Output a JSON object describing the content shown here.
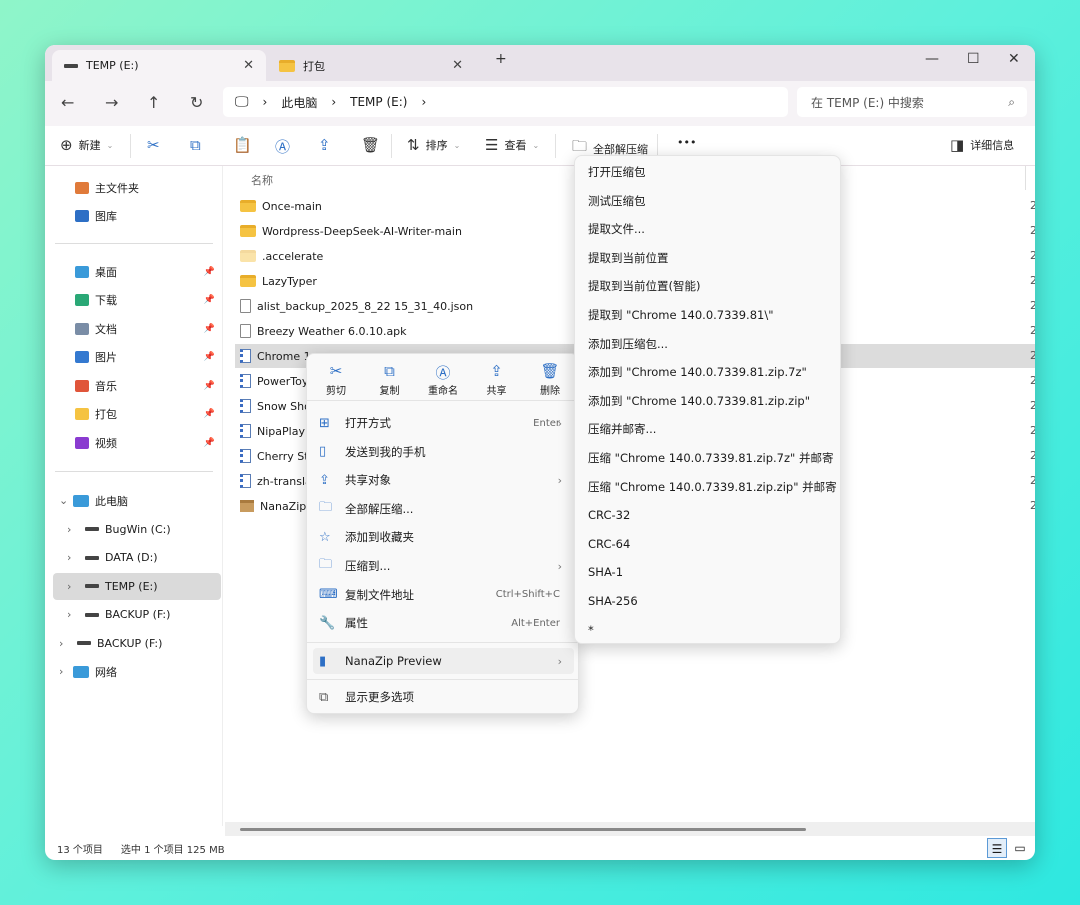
{
  "tabs": [
    {
      "label": "TEMP (E:)",
      "icon": "drive-icon"
    },
    {
      "label": "打包",
      "icon": "folder-icon"
    }
  ],
  "window": {
    "new_tab": "+",
    "minimize": "—",
    "maximize": "☐",
    "close": "✕"
  },
  "address": {
    "segments": [
      "此电脑",
      "TEMP (E:)"
    ],
    "search_placeholder": "在 TEMP (E:) 中搜索"
  },
  "toolbar": {
    "new": "新建",
    "sort": "排序",
    "view": "查看",
    "extract_all": "全部解压缩",
    "more": "•••",
    "details": "详细信息"
  },
  "sidebar": {
    "top": [
      {
        "label": "主文件夹",
        "color": "#e07a3a"
      },
      {
        "label": "图库",
        "color": "#2d6fc5"
      }
    ],
    "pinned": [
      {
        "label": "桌面",
        "color": "#3a9ad9"
      },
      {
        "label": "下载",
        "color": "#2aa876"
      },
      {
        "label": "文档",
        "color": "#7a8da6"
      },
      {
        "label": "图片",
        "color": "#3479d0"
      },
      {
        "label": "音乐",
        "color": "#e0553a"
      },
      {
        "label": "打包",
        "color": "#f5c342"
      },
      {
        "label": "视频",
        "color": "#8a3bd0"
      }
    ],
    "tree": [
      {
        "label": "此电脑",
        "level": 0,
        "chev": "⌄"
      },
      {
        "label": "BugWin (C:)",
        "level": 1,
        "chev": "›"
      },
      {
        "label": "DATA (D:)",
        "level": 1,
        "chev": "›"
      },
      {
        "label": "TEMP (E:)",
        "level": 1,
        "chev": "›",
        "selected": true
      },
      {
        "label": "BACKUP (F:)",
        "level": 1,
        "chev": "›"
      },
      {
        "label": "BACKUP (F:)",
        "level": 0,
        "chev": "›"
      },
      {
        "label": "网络",
        "level": 0,
        "chev": "›"
      }
    ]
  },
  "list": {
    "header_name": "名称",
    "date_prefix": "2",
    "files": [
      {
        "name": "Once-main",
        "type": "folder"
      },
      {
        "name": "Wordpress-DeepSeek-AI-Writer-main",
        "type": "folder"
      },
      {
        "name": ".accelerate",
        "type": "folder-light"
      },
      {
        "name": "LazyTyper",
        "type": "folder"
      },
      {
        "name": "alist_backup_2025_8_22 15_31_40.json",
        "type": "file"
      },
      {
        "name": "Breezy Weather 6.0.10.apk",
        "type": "file"
      },
      {
        "name": "Chrome 1",
        "type": "zip",
        "selected": true
      },
      {
        "name": "PowerToy",
        "type": "zip"
      },
      {
        "name": "Snow Sho",
        "type": "zip"
      },
      {
        "name": "NipaPlay",
        "type": "zip"
      },
      {
        "name": "Cherry St",
        "type": "zip"
      },
      {
        "name": "zh-transla",
        "type": "zip"
      },
      {
        "name": "NanaZipP",
        "type": "box"
      }
    ]
  },
  "status": {
    "count": "13 个项目",
    "selected": "选中 1 个项目  125 MB"
  },
  "context_menu": {
    "quick": [
      {
        "label": "剪切",
        "icon": "✂"
      },
      {
        "label": "复制",
        "icon": "⧉"
      },
      {
        "label": "重命名",
        "icon": "Ⓐ"
      },
      {
        "label": "共享",
        "icon": "⇪"
      },
      {
        "label": "删除",
        "icon": "🗑"
      }
    ],
    "items": [
      {
        "label": "打开方式",
        "shortcut": "Enter",
        "arrow": true,
        "icon": "⊞"
      },
      {
        "label": "发送到我的手机",
        "icon": "▯"
      },
      {
        "label": "共享对象",
        "arrow": true,
        "icon": "⇪"
      },
      {
        "label": "全部解压缩...",
        "icon": "🗀"
      },
      {
        "label": "添加到收藏夹",
        "icon": "☆"
      },
      {
        "label": "压缩到...",
        "arrow": true,
        "icon": "🗀"
      },
      {
        "label": "复制文件地址",
        "shortcut": "Ctrl+Shift+C",
        "icon": "⌨"
      },
      {
        "label": "属性",
        "shortcut": "Alt+Enter",
        "icon": "🔧"
      }
    ],
    "nanazip": {
      "label": "NanaZip Preview",
      "arrow": true
    },
    "more": "显示更多选项"
  },
  "submenu": [
    "打开压缩包",
    "测试压缩包",
    "提取文件...",
    "提取到当前位置",
    "提取到当前位置(智能)",
    "提取到 \"Chrome 140.0.7339.81\\\"",
    "添加到压缩包...",
    "添加到 \"Chrome 140.0.7339.81.zip.7z\"",
    "添加到 \"Chrome 140.0.7339.81.zip.zip\"",
    "压缩并邮寄...",
    "压缩 \"Chrome 140.0.7339.81.zip.7z\" 并邮寄",
    "压缩 \"Chrome 140.0.7339.81.zip.zip\" 并邮寄",
    "CRC-32",
    "CRC-64",
    "SHA-1",
    "SHA-256",
    "*"
  ]
}
